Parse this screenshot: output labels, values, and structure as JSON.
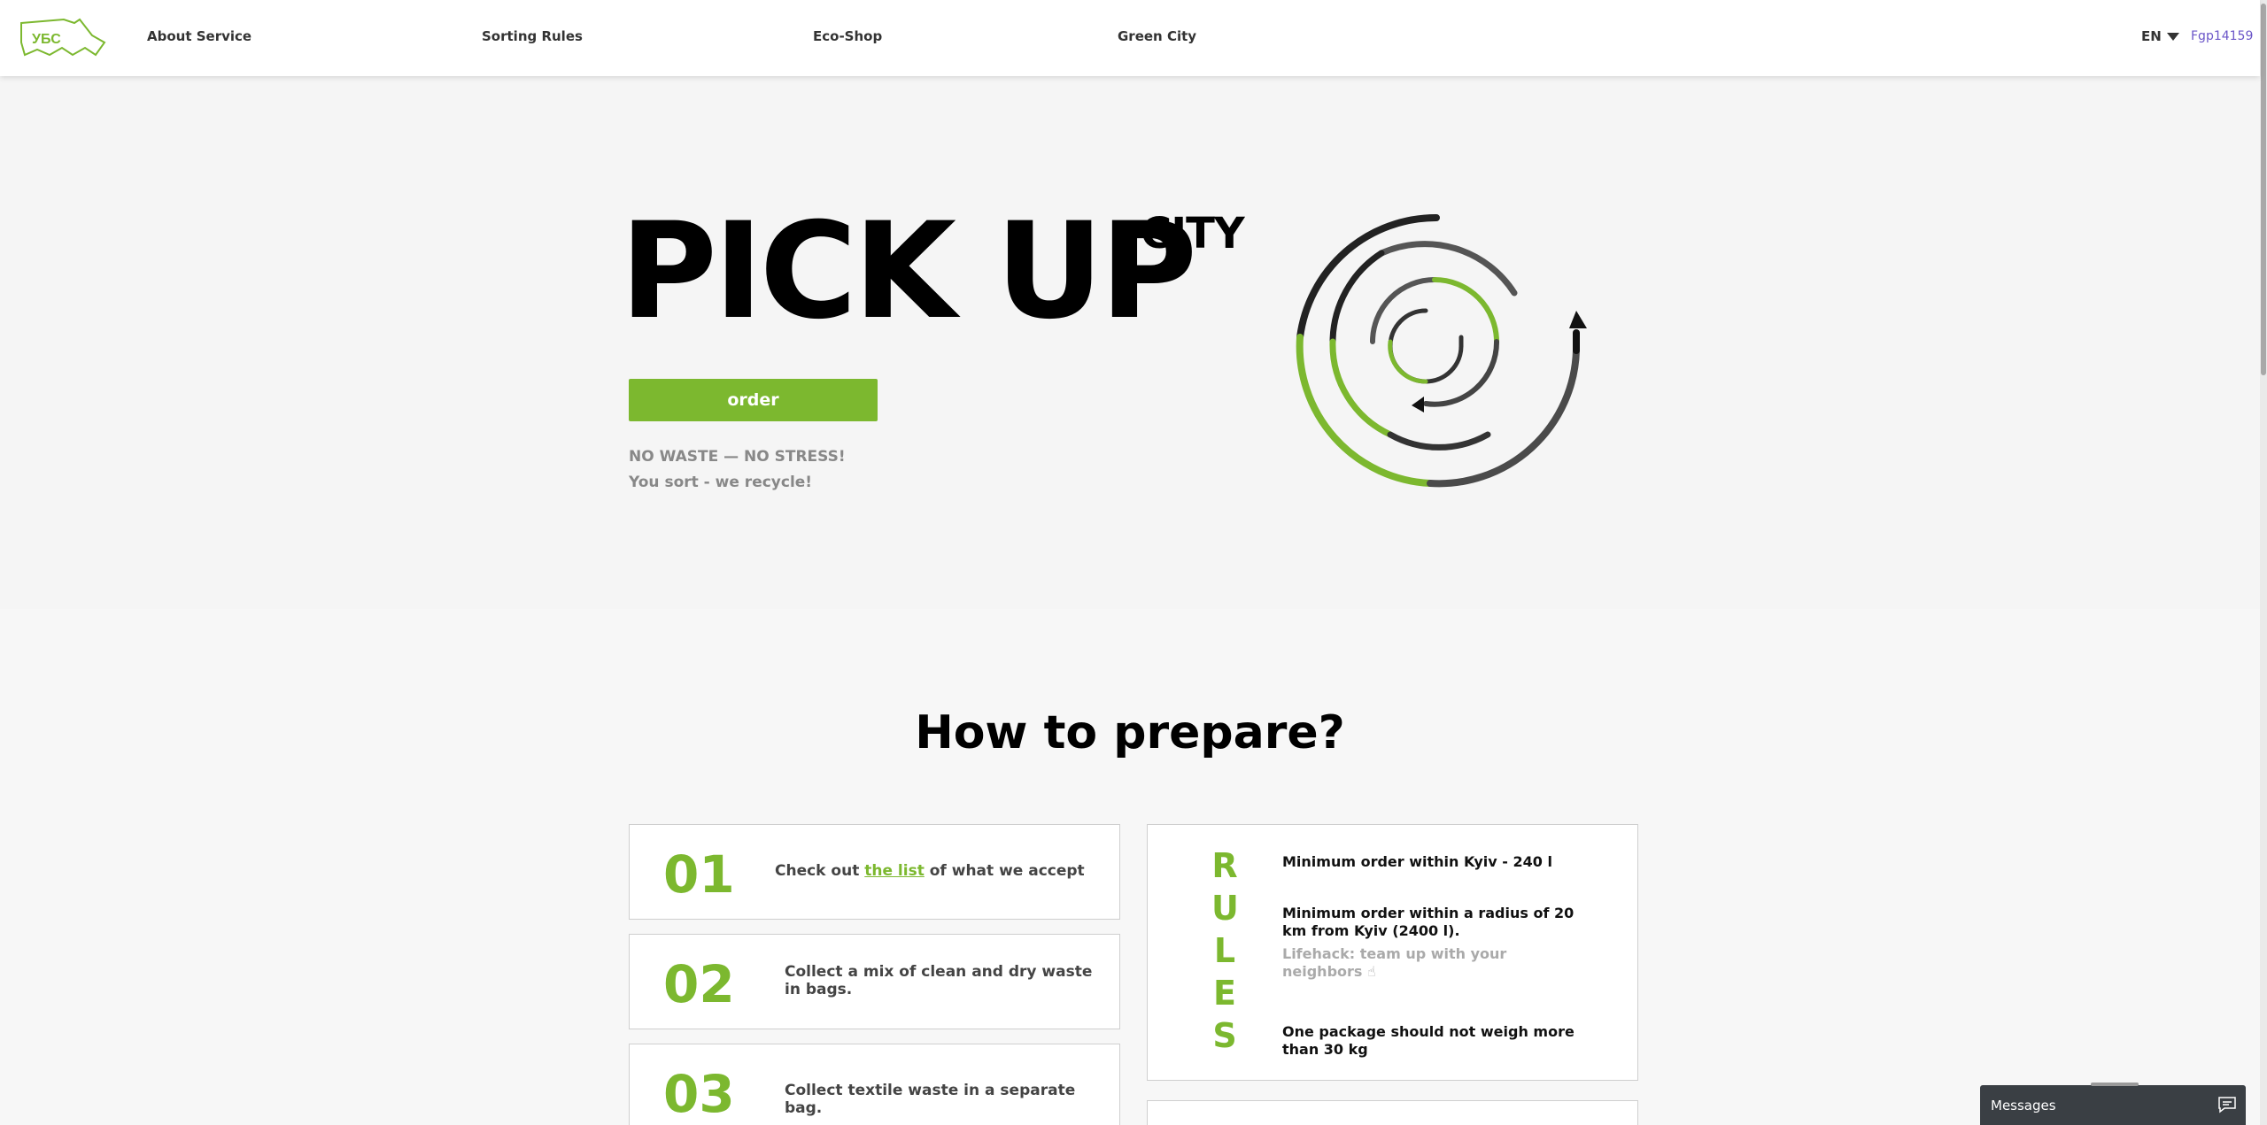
{
  "header": {
    "logo_text": "УБС",
    "nav": [
      "About Service",
      "Sorting Rules",
      "Eco-Shop",
      "Green City"
    ],
    "language": "EN",
    "user": "Fgp14159"
  },
  "hero": {
    "title": "PICK UP",
    "superscript": "CITY",
    "order_button": "order",
    "slogan_1": "NO WASTE — NO STRESS!",
    "slogan_2": "You sort - we recycle!"
  },
  "prepare": {
    "title": "How to prepare?",
    "steps": [
      {
        "number": "01",
        "text_before": "Check out",
        "link": "the list",
        "text_after": "of what we accept"
      },
      {
        "number": "02",
        "text": "Collect a mix of clean and dry waste in bags."
      },
      {
        "number": "03",
        "text": "Collect textile waste in a separate bag."
      }
    ],
    "rules": {
      "letters": [
        "R",
        "U",
        "L",
        "E",
        "S"
      ],
      "items": [
        "Minimum order within Kyiv - 240 l",
        "Minimum order within a radius of 20 km from Kyiv (2400 l).",
        "One package should not weigh more than 30 kg"
      ],
      "tip": "Lifehack: team up with your neighbors ☝"
    }
  },
  "messages": {
    "label": "Messages"
  },
  "colors": {
    "accent": "#7cb82f",
    "text": "#111111",
    "muted": "#888888",
    "user_link": "#6b56c8"
  },
  "icons": [
    "logo-icon",
    "caret-down-icon",
    "recycle-arrow-icon",
    "chat-icon"
  ]
}
